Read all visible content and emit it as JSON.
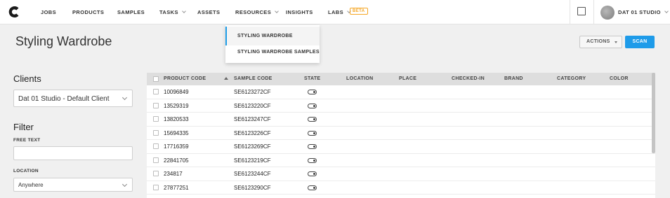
{
  "nav": {
    "items": [
      "JOBS",
      "PRODUCTS",
      "SAMPLES",
      "TASKS",
      "ASSETS",
      "RESOURCES",
      "INSIGHTS",
      "LABS"
    ],
    "beta_badge": "BETA",
    "user_name": "DAT 01 STUDIO"
  },
  "resources_menu": {
    "items": [
      "STYLING WARDROBE",
      "STYLING WARDROBE SAMPLES"
    ],
    "active_item": "STYLING WARDROBE"
  },
  "page": {
    "title": "Styling Wardrobe",
    "actions_label": "ACTIONS",
    "scan_label": "SCAN"
  },
  "sidebar": {
    "clients_heading": "Clients",
    "client_selected": "Dat 01 Studio - Default Client",
    "filter_heading": "Filter",
    "free_text_label": "FREE TEXT",
    "free_text_value": "",
    "location_label": "LOCATION",
    "location_selected": "Anywhere"
  },
  "table": {
    "columns": [
      "PRODUCT CODE",
      "SAMPLE CODE",
      "STATE",
      "LOCATION",
      "PLACE",
      "CHECKED-IN",
      "BRAND",
      "CATEGORY",
      "COLOR"
    ],
    "sort_column": "PRODUCT CODE",
    "sort_direction": "ascending",
    "rows": [
      {
        "product_code": "10096849",
        "sample_code": "SE6123272CF"
      },
      {
        "product_code": "13529319",
        "sample_code": "SE6123220CF"
      },
      {
        "product_code": "13820533",
        "sample_code": "SE6123247CF"
      },
      {
        "product_code": "15694335",
        "sample_code": "SE6123226CF"
      },
      {
        "product_code": "17716359",
        "sample_code": "SE6123269CF"
      },
      {
        "product_code": "22841705",
        "sample_code": "SE6123219CF"
      },
      {
        "product_code": "234817",
        "sample_code": "SE6123244CF"
      },
      {
        "product_code": "27877251",
        "sample_code": "SE6123290CF"
      }
    ]
  },
  "colors": {
    "accent": "#1e9be9",
    "beta": "#f5a623",
    "background": "#f0f0f0"
  },
  "icons": {
    "logo": "c-logo-icon",
    "messages": "message-box-icon"
  }
}
